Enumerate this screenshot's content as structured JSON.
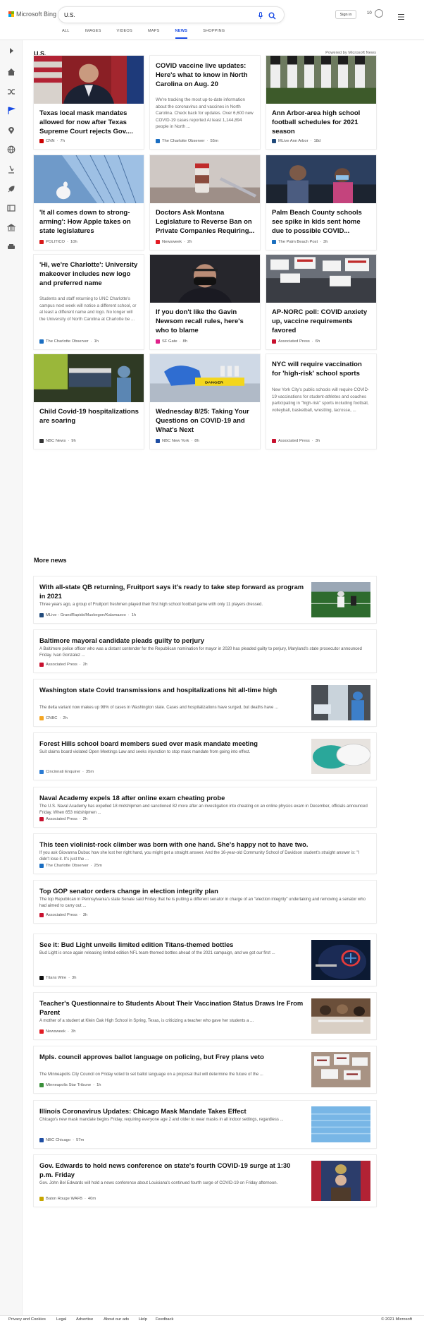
{
  "header": {
    "logo_text": "Microsoft Bing",
    "search_value": "U.S.",
    "tabs": [
      "ALL",
      "IMAGES",
      "VIDEOS",
      "MAPS",
      "NEWS",
      "SHOPPING"
    ],
    "active_tab": "NEWS",
    "signin_label": "Sign in",
    "points": "10"
  },
  "topic": {
    "title": "U.S.",
    "powered_by": "Powered by Microsoft News"
  },
  "top_cards": [
    {
      "title": "Texas local mask mandates allowed for now after Texas Supreme Court rejects Gov....",
      "source": "CNN",
      "age": "7h",
      "src_color": "#cc0000",
      "image": "governor"
    },
    {
      "title": "COVID vaccine live updates: Here's what to know in North Carolina on Aug. 20",
      "snippet": "We're tracking the most up-to-date information about the coronavirus and vaccines in North Carolina. Check back for updates. Over 6,600 new COVID-19 cases reported At least 1,144,894 people in North ...",
      "source": "The Charlotte Observer",
      "age": "55m",
      "src_color": "#1a6ec2"
    },
    {
      "title": "Ann Arbor-area high school football schedules for 2021 season",
      "source": "MLive Ann Arbor",
      "age": "18d",
      "src_color": "#214a7b",
      "image": "football"
    },
    {
      "title": "'It all comes down to strong-arming': How Apple takes on state legislatures",
      "source": "POLITICO",
      "age": "10h",
      "src_color": "#d91a1a",
      "image": "apple"
    },
    {
      "title": "Doctors Ask Montana Legislature to Reverse Ban on Private Companies Requiring...",
      "source": "Newsweek",
      "age": "2h",
      "src_color": "#e31b23",
      "image": "vaccine"
    },
    {
      "title": "Palm Beach County schools see spike in kids sent home due to possible COVID...",
      "source": "The Palm Beach Post",
      "age": "3h",
      "src_color": "#1b6fbe",
      "image": "school"
    },
    {
      "title": "'Hi, we're Charlotte': University makeover includes new logo and preferred name",
      "snippet": "Students and staff returning to UNC Charlotte's campus next week will notice a different school, or at least a different name and logo. No longer will the University of North Carolina at Charlotte be ...",
      "source": "The Charlotte Observer",
      "age": "1h",
      "src_color": "#1a6ec2"
    },
    {
      "title": "If you don't like the Gavin Newsom recall rules, here's who to blame",
      "source": "SF Gate",
      "age": "8h",
      "src_color": "#e0218a",
      "image": "newsom"
    },
    {
      "title": "AP-NORC poll: COVID anxiety up, vaccine requirements favored",
      "source": "Associated Press",
      "age": "6h",
      "src_color": "#c8102e",
      "image": "protest"
    },
    {
      "title": "Child Covid-19 hospitalizations are soaring",
      "source": "NBC News",
      "age": "9h",
      "src_color": "#333333",
      "image": "hospital"
    },
    {
      "title": "Wednesday 8/25: Taking Your Questions on COVID-19 and What's Next",
      "source": "NBC New York",
      "age": "8h",
      "src_color": "#1f4ea3",
      "image": "lab"
    },
    {
      "title": "NYC will require vaccination for 'high-risk' school sports",
      "snippet": "New York City's public schools will require COVID-19 vaccinations for student-athletes and coaches participating in \"high-risk\" sports including football, volleyball, basketball, wrestling, lacrosse, ...",
      "source": "Associated Press",
      "age": "3h",
      "src_color": "#c8102e"
    }
  ],
  "more_news_title": "More news",
  "more_news": [
    {
      "title": "With all-state QB returning, Fruitport says it's ready to take step forward as program in 2021",
      "snippet": "Three years ago, a group of Fruitport freshmen played their first high school football game with only 11 players dressed.",
      "source": "MLive - GrandRapids/Muskegon/Kalamazoo",
      "age": "1h",
      "src_color": "#214a7b",
      "image": "field"
    },
    {
      "title": "Baltimore mayoral candidate pleads guilty to perjury",
      "snippet": "A Baltimore police officer who was a distant contender for the Republican nomination for mayor in 2020 has pleaded guilty to perjury, Maryland's state prosecutor announced Friday. Ivan Gonzalez ...",
      "source": "Associated Press",
      "age": "2h",
      "src_color": "#c8102e"
    },
    {
      "title": "Washington state Covid transmissions and hospitalizations hit all-time high",
      "snippet": "The delta variant now makes up 98% of cases in Washington state. Cases and hospitalizations have surged, but deaths have ...",
      "source": "CNBC",
      "age": "2h",
      "src_color": "#f5a623",
      "image": "ward"
    },
    {
      "title": "Forest Hills school board members sued over mask mandate meeting",
      "snippet": "Suit claims board violated Open Meetings Law and seeks injunction to stop mask mandate from going into effect.",
      "source": "Cincinnati Enquirer",
      "age": "35m",
      "src_color": "#2b7bd3",
      "image": "masks"
    },
    {
      "title": "Naval Academy expels 18 after online exam cheating probe",
      "snippet": "The U.S. Naval Academy has expelled 18 midshipmen and sanctioned 82 more after an investigation into cheating on an online physics exam in December, officials announced Friday. When 653 midshipmen ...",
      "source": "Associated Press",
      "age": "2h",
      "src_color": "#c8102e"
    },
    {
      "title": "This teen violinist-rock climber was born with one hand. She's happy not to have two.",
      "snippet": "If you ask Giovanna Dubuc how she lost her right hand, you might get a straight answer. And the 16-year-old Community School of Davidson student's straight answer is: \"I didn't lose it. It's just the ...",
      "source": "The Charlotte Observer",
      "age": "25m",
      "src_color": "#1a6ec2"
    },
    {
      "title": "Top GOP senator orders change in election integrity plan",
      "snippet": "The top Republican in Pennsylvania's state Senate said Friday that he is putting a different senator in charge of an \"election integrity\" undertaking and removing a senator who had aimed to carry out ...",
      "source": "Associated Press",
      "age": "3h",
      "src_color": "#c8102e"
    },
    {
      "title": "See it: Bud Light unveils limited edition Titans-themed bottles",
      "snippet": "Bud Light is once again releasing limited edition NFL team-themed bottles ahead of the 2021 campaign, and we got our first ...",
      "source": "Titans Wire",
      "age": "3h",
      "src_color": "#111111",
      "image": "helmet"
    },
    {
      "title": "Teacher's Questionnaire to Students About Their Vaccination Status Draws Ire From Parent",
      "snippet": "A mother of a student at Klein Oak High School in Spring, Texas, is criticizing a teacher who gave her students a ...",
      "source": "Newsweek",
      "age": "3h",
      "src_color": "#e31b23",
      "image": "class"
    },
    {
      "title": "Mpls. council approves ballot language on policing, but Frey plans veto",
      "snippet": "The Minneapolis City Council on Friday voted to set ballot language on a proposal that will determine the future of the ...",
      "source": "Minneapolis Star Tribune",
      "age": "1h",
      "src_color": "#3a8f3a",
      "image": "signs"
    },
    {
      "title": "Illinois Coronavirus Updates: Chicago Mask Mandate Takes Effect",
      "snippet": "Chicago's new mask mandate begins Friday, requiring everyone age 2 and older to wear masks in all indoor settings, regardless ...",
      "source": "NBC Chicago",
      "age": "57m",
      "src_color": "#1f4ea3",
      "image": "bluemasks"
    },
    {
      "title": "Gov. Edwards to hold news conference on state's fourth COVID-19 surge at 1:30 p.m. Friday",
      "snippet": "Gov. John Bel Edwards will hold a news conference about Louisiana's continued fourth surge of COVID-19 on Friday afternoon.",
      "source": "Baton Rouge WAFB",
      "age": "40m",
      "src_color": "#c7a600",
      "image": "podium"
    }
  ],
  "footer": {
    "links": [
      "Privacy and Cookies",
      "Legal",
      "Advertise",
      "About our ads",
      "Help",
      "Feedback"
    ],
    "copyright": "© 2021 Microsoft"
  },
  "icons": {
    "search": "search-icon",
    "mic": "microphone-icon",
    "trophy": "rewards-icon",
    "menu": "hamburger-menu-icon"
  },
  "colors": {
    "accent": "#174ae4"
  }
}
